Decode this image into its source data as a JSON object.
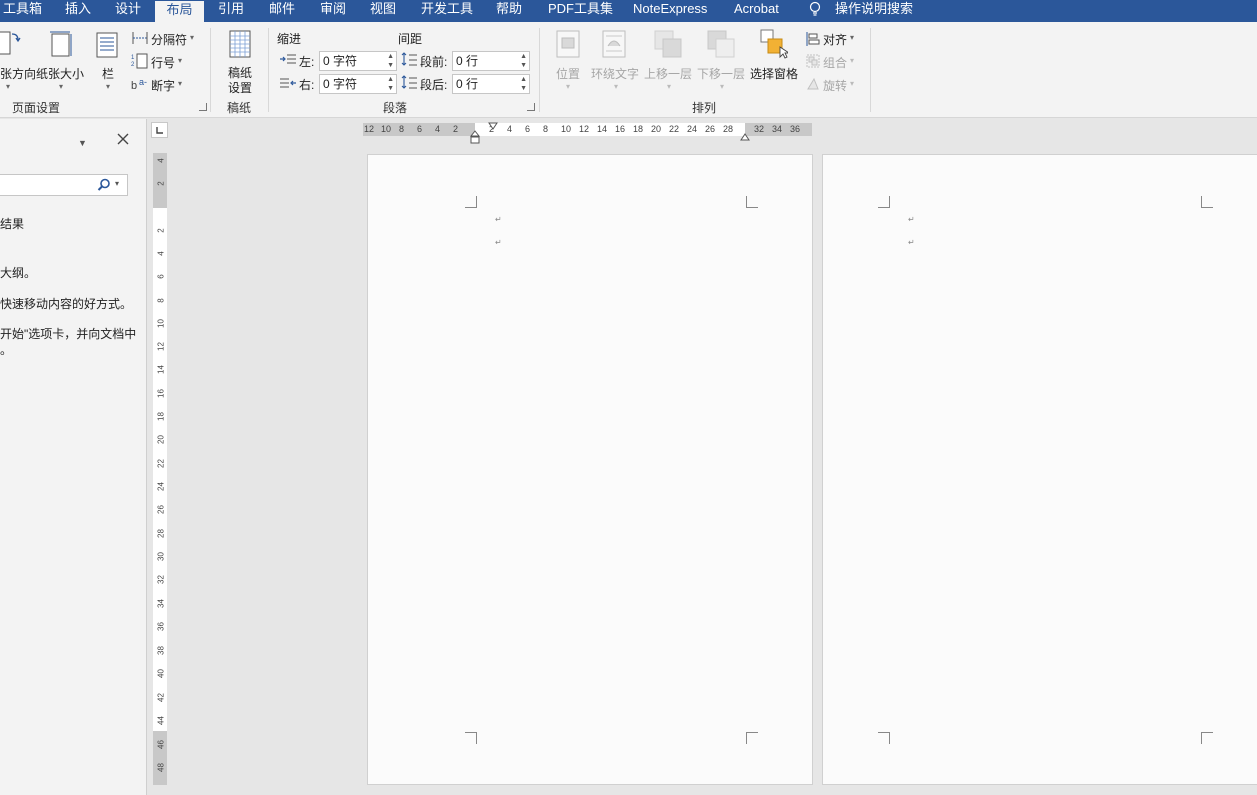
{
  "menu": {
    "tabs": [
      "工具箱",
      "插入",
      "设计",
      "布局",
      "引用",
      "邮件",
      "审阅",
      "视图",
      "开发工具",
      "帮助",
      "PDF工具集",
      "NoteExpress",
      "Acrobat"
    ],
    "active_tab": "布局",
    "tell_me": "操作说明搜索"
  },
  "ribbon": {
    "page_setup": {
      "orientation": "纸张方向",
      "size": "纸张大小",
      "columns": "栏",
      "breaks": "分隔符",
      "line_numbers": "行号",
      "hyphenation": "断字",
      "group_label": "页面设置"
    },
    "manuscript": {
      "button": "稿纸设置",
      "button_line1": "稿纸",
      "button_line2": "设置",
      "group_label": "稿纸"
    },
    "paragraph": {
      "indent_label": "缩进",
      "spacing_label": "间距",
      "left_label": "左:",
      "right_label": "右:",
      "before_label": "段前:",
      "after_label": "段后:",
      "left_value": "0 字符",
      "right_value": "0 字符",
      "before_value": "0 行",
      "after_value": "0 行",
      "group_label": "段落"
    },
    "arrange": {
      "position": "位置",
      "wrap_text": "环绕文字",
      "bring_forward": "上移一层",
      "send_backward": "下移一层",
      "selection_pane": "选择窗格",
      "align": "对齐",
      "group": "组合",
      "rotate": "旋转",
      "group_label": "排列"
    }
  },
  "nav_pane": {
    "results_text": "结果",
    "line1": "大纲。",
    "line2": "快速移动内容的好方式。",
    "line3": "开始\"选项卡，并向文档中",
    "line4": "。"
  },
  "ruler": {
    "h_numbers": [
      "12",
      "10",
      "8",
      "6",
      "4",
      "2",
      "2",
      "4",
      "6",
      "8",
      "10",
      "12",
      "14",
      "16",
      "18",
      "20",
      "22",
      "24",
      "26",
      "28",
      "32",
      "34",
      "36"
    ],
    "v_numbers": [
      "4",
      "2",
      "2",
      "4",
      "6",
      "8",
      "10",
      "12",
      "14",
      "16",
      "18",
      "20",
      "22",
      "24",
      "26",
      "28",
      "30",
      "32",
      "34",
      "36",
      "38",
      "40",
      "42",
      "44",
      "46",
      "48"
    ]
  },
  "colors": {
    "accent": "#2b579a",
    "ribbon_bg": "#f3f3f3",
    "workspace_bg": "#e6e6e6",
    "page_bg": "#fbfbfb"
  },
  "icons": [
    "orientation-icon",
    "size-icon",
    "columns-icon",
    "breaks-icon",
    "line-numbers-icon",
    "hyphenation-icon",
    "manuscript-icon",
    "indent-left-icon",
    "indent-right-icon",
    "spacing-before-icon",
    "spacing-after-icon",
    "position-icon",
    "wrap-text-icon",
    "bring-forward-icon",
    "send-backward-icon",
    "selection-pane-icon",
    "align-icon",
    "group-icon",
    "rotate-icon",
    "lightbulb-icon",
    "search-icon",
    "close-icon",
    "chevron-down-icon"
  ]
}
